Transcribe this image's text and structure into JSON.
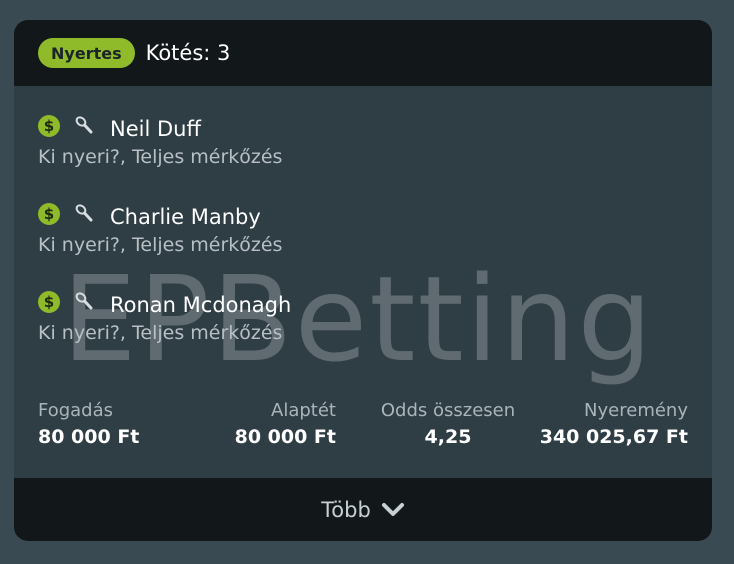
{
  "header": {
    "status_badge": "Nyertes",
    "title": "Kötés: 3"
  },
  "watermark": "EPBetting",
  "selections": [
    {
      "icon": "dollar-icon",
      "sport_icon": "tennis-racket-icon",
      "name": "Neil Duff",
      "market": "Ki nyeri?, Teljes mérkőzés"
    },
    {
      "icon": "dollar-icon",
      "sport_icon": "tennis-racket-icon",
      "name": "Charlie Manby",
      "market": "Ki nyeri?, Teljes mérkőzés"
    },
    {
      "icon": "dollar-icon",
      "sport_icon": "tennis-racket-icon",
      "name": "Ronan Mcdonagh",
      "market": "Ki nyeri?, Teljes mérkőzés"
    }
  ],
  "summary": {
    "stake_label": "Fogadás",
    "stake_value": "80 000 Ft",
    "base_label": "Alaptét",
    "base_value": "80 000 Ft",
    "odds_label": "Odds összesen",
    "odds_value": "4,25",
    "winnings_label": "Nyeremény",
    "winnings_value": "340 025,67 Ft"
  },
  "footer": {
    "more_label": "Több"
  },
  "colors": {
    "accent": "#8fba2a",
    "background": "#3a4a53",
    "card": "#2f3d44",
    "header": "#12171a"
  }
}
